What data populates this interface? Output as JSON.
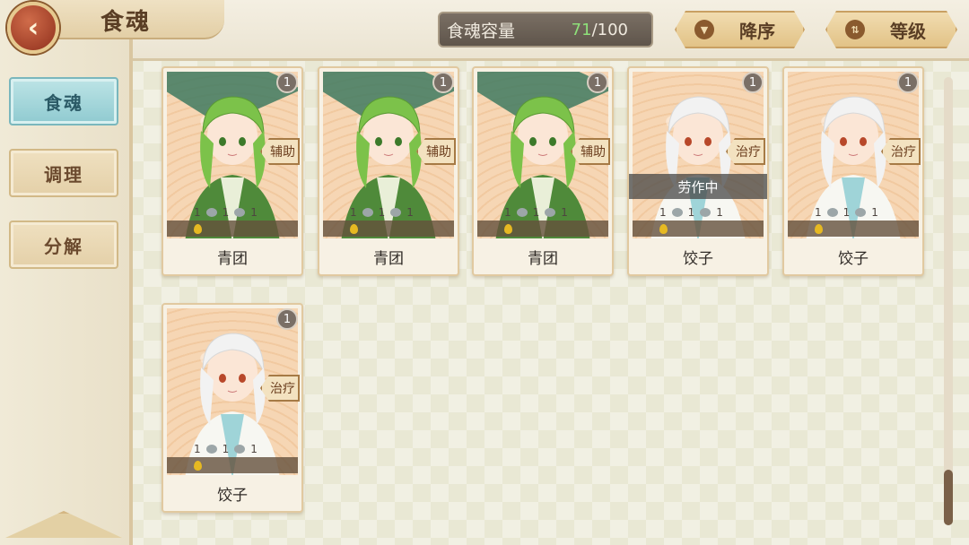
{
  "header": {
    "title": "食魂",
    "capacity_label": "食魂容量",
    "capacity_current": "71",
    "capacity_total": "/100",
    "sort_order_label": "降序",
    "sort_field_label": "等级"
  },
  "sidebar": {
    "tabs": [
      {
        "label": "食魂",
        "active": true
      },
      {
        "label": "调理",
        "active": false
      },
      {
        "label": "分解",
        "active": false
      }
    ]
  },
  "cards": [
    {
      "name": "青团",
      "level": "1",
      "role": "辅助",
      "stats": [
        "1",
        "1",
        "1"
      ],
      "status": "",
      "theme": "green"
    },
    {
      "name": "青团",
      "level": "1",
      "role": "辅助",
      "stats": [
        "1",
        "1",
        "1"
      ],
      "status": "",
      "theme": "green"
    },
    {
      "name": "青团",
      "level": "1",
      "role": "辅助",
      "stats": [
        "1",
        "1",
        "1"
      ],
      "status": "",
      "theme": "green"
    },
    {
      "name": "饺子",
      "level": "1",
      "role": "治疗",
      "stats": [
        "1",
        "1",
        "1"
      ],
      "status": "劳作中",
      "theme": "white"
    },
    {
      "name": "饺子",
      "level": "1",
      "role": "治疗",
      "stats": [
        "1",
        "1",
        "1"
      ],
      "status": "",
      "theme": "white"
    },
    {
      "name": "饺子",
      "level": "1",
      "role": "治疗",
      "stats": [
        "1",
        "1",
        "1"
      ],
      "status": "",
      "theme": "white"
    }
  ],
  "colors": {
    "accent_tab": "#8fcad0",
    "capacity_current": "#8ee07a",
    "back_button": "#8f2f1c"
  }
}
